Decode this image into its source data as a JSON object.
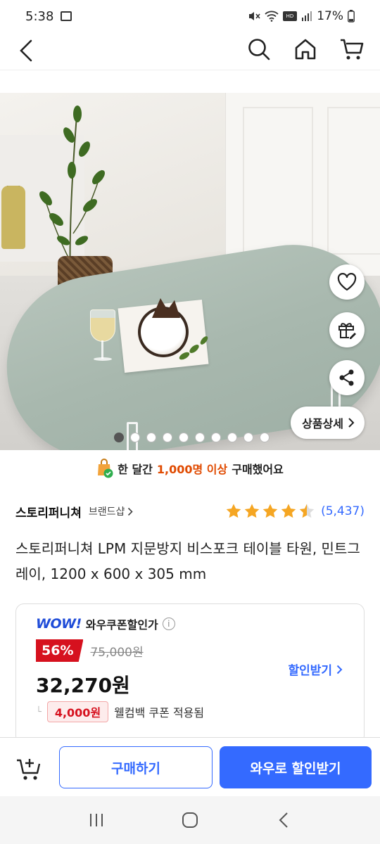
{
  "status_bar": {
    "time": "5:38",
    "battery": "17%"
  },
  "product": {
    "brand": "스토리퍼니쳐",
    "brand_shop": "브랜드샵",
    "rating_stars": 4.5,
    "review_count": "(5,437)",
    "title": "스토리퍼니쳐 LPM 지문방지 비스포크 테이블 타원, 민트그레이, 1200 x 600 x 305 mm"
  },
  "gallery": {
    "detail_button": "상품상세",
    "image_count": 10,
    "current_index": 0
  },
  "buyers_banner": {
    "prefix": "한 달간",
    "highlight": "1,000명 이상",
    "suffix": "구매했어요"
  },
  "price_card": {
    "wow_logo": "WOW!",
    "wow_label": "와우쿠폰할인가",
    "discount_rate": "56%",
    "original_price": "75,000원",
    "final_price": "32,270원",
    "get_discount": "할인받기",
    "coupon_amount": "4,000원",
    "coupon_label": "웰컴백 쿠폰 적용됨"
  },
  "bottom_bar": {
    "buy_label": "구매하기",
    "wow_label": "와우로 할인받기"
  },
  "colors": {
    "accent": "#346aff",
    "discount": "#d6111e",
    "highlight": "#e04a00",
    "star": "#f5a623"
  }
}
